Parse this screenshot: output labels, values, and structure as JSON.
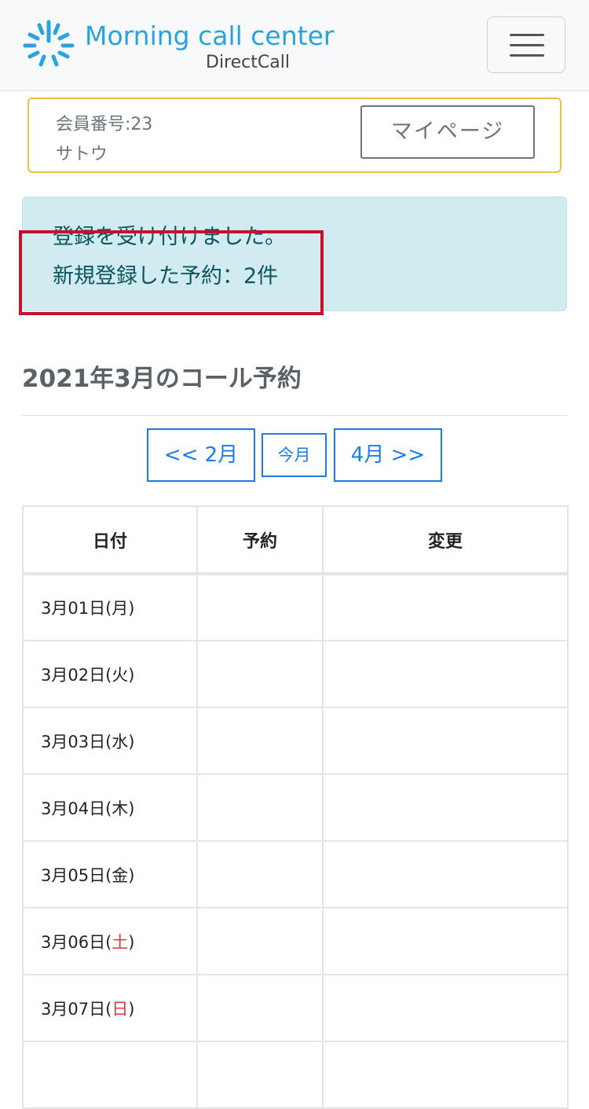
{
  "header": {
    "brand_title": "Morning call center",
    "brand_subtitle": "DirectCall",
    "brand_color": "#29a3dc",
    "menu_icon": "hamburger-icon"
  },
  "member": {
    "id_label": "会員番号:23",
    "name": "サトウ",
    "mypage_button": "マイページ"
  },
  "alert": {
    "line1": "登録を受け付けました。",
    "line2": "新規登録した予約：2件",
    "highlight_color": "#c8102e"
  },
  "calendar": {
    "title": "2021年3月のコール予約",
    "prev_label": "<< 2月",
    "today_label": "今月",
    "next_label": "4月 >>",
    "columns": [
      "日付",
      "予約",
      "変更"
    ],
    "rows": [
      {
        "date": "3月01日(",
        "weekday": "月",
        "close": ")",
        "weekend": false,
        "reservation": "",
        "change": ""
      },
      {
        "date": "3月02日(",
        "weekday": "火",
        "close": ")",
        "weekend": false,
        "reservation": "",
        "change": ""
      },
      {
        "date": "3月03日(",
        "weekday": "水",
        "close": ")",
        "weekend": false,
        "reservation": "",
        "change": ""
      },
      {
        "date": "3月04日(",
        "weekday": "木",
        "close": ")",
        "weekend": false,
        "reservation": "",
        "change": ""
      },
      {
        "date": "3月05日(",
        "weekday": "金",
        "close": ")",
        "weekend": false,
        "reservation": "",
        "change": ""
      },
      {
        "date": "3月06日(",
        "weekday": "土",
        "close": ")",
        "weekend": true,
        "reservation": "",
        "change": ""
      },
      {
        "date": "3月07日(",
        "weekday": "日",
        "close": ")",
        "weekend": true,
        "reservation": "",
        "change": ""
      }
    ]
  },
  "colors": {
    "link_blue": "#1a7ee6",
    "alert_bg": "#d1ecf1",
    "alert_text": "#0c5460",
    "member_border": "#f0c040",
    "weekend_red": "#dc3545"
  }
}
